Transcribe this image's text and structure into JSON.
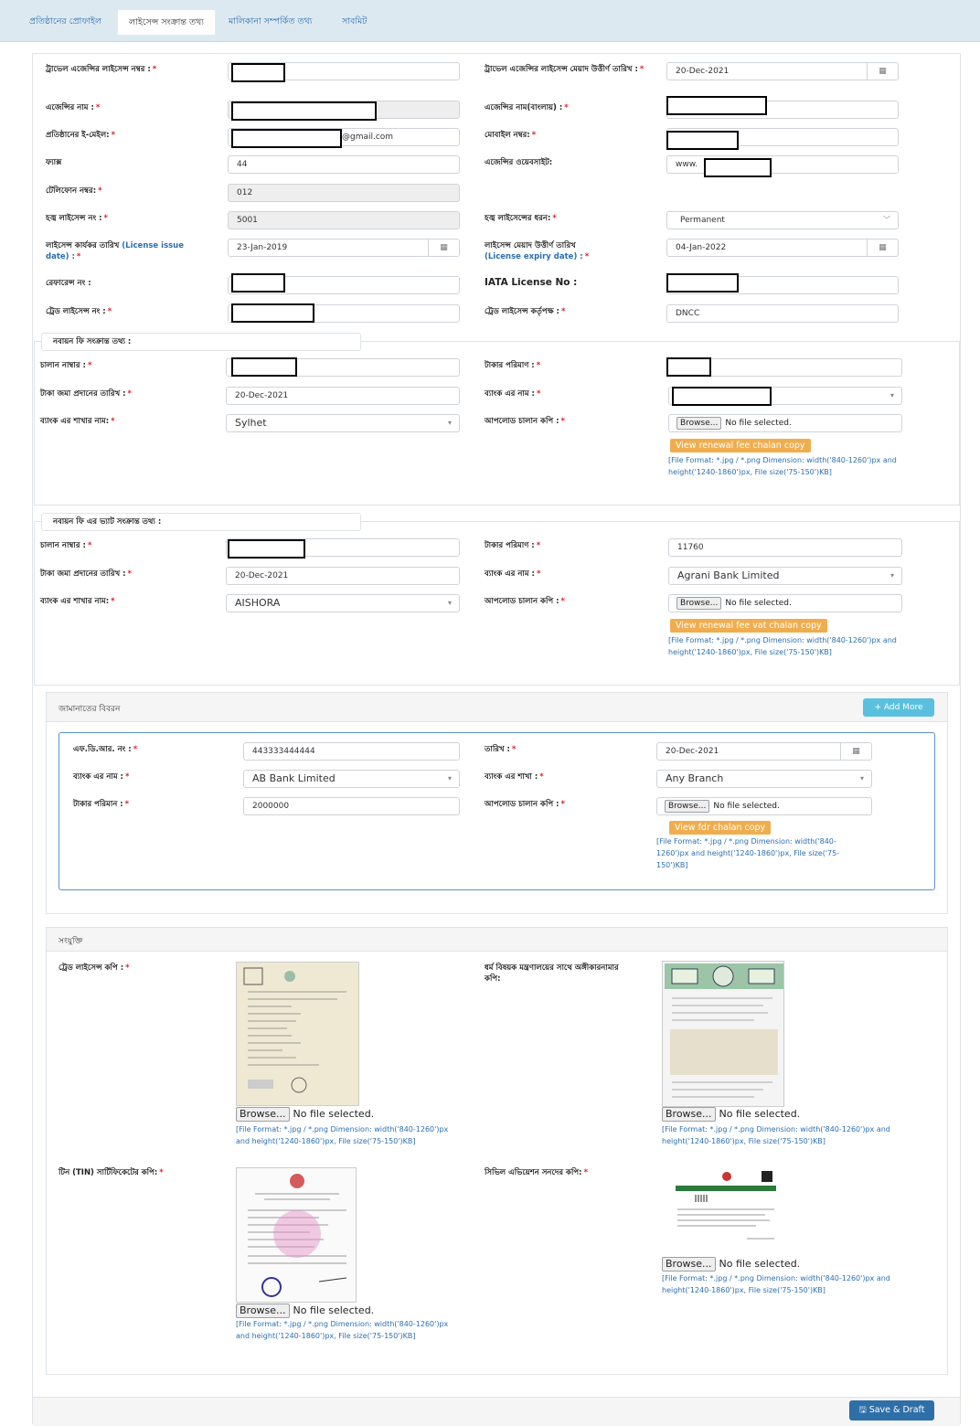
{
  "tabs": [
    {
      "label": "প্রতিষ্ঠানের প্রোফাইল",
      "active": false
    },
    {
      "label": "লাইসেন্স সংক্রান্ত তথ্য",
      "active": true
    },
    {
      "label": "মালিকানা সম্পর্কিত তথ্য",
      "active": false
    },
    {
      "label": "সাবমিট",
      "active": false
    }
  ],
  "license": {
    "travel_license_no_label": "ট্রাভেল এজেন্সির লাইসেন্স নম্বর :",
    "travel_license_expiry_label": "ট্রাভেল এজেন্সির লাইসেন্স মেয়াদ উত্তীর্ণ তারিখ :",
    "travel_license_expiry_value": "20-Dec-2021",
    "agency_name_label": "এজেন্সির নাম :",
    "agency_name_bn_label": "এজেন্সির নাম(বাংলায়) :",
    "email_label": "প্রতিষ্ঠানের ই-মেইল:",
    "email_suffix": "@gmail.com",
    "mobile_label": "মোবাইল নম্বর:",
    "fax_label": "ফ্যাক্স",
    "fax_value": "44",
    "website_label": "এজেন্সির ওয়েবসাইট:",
    "website_prefix": "www.",
    "phone_label": "টেলিফোন নম্বর:",
    "phone_value": "012",
    "hajj_license_label": "হজ্ব লাইসেন্স নং :",
    "hajj_license_value": "5001",
    "hajj_license_type_label": "হজ্ব লাইসেন্সের ধরন:",
    "hajj_license_type_value": "Permanent",
    "issue_date_label_bn": "লাইসেন্স কার্যকর তারিখ",
    "issue_date_label_en": "(License issue date) :",
    "issue_date_value": "23-Jan-2019",
    "expiry_date_label_bn": "লাইসেন্স মেয়াদ উত্তীর্ণ তারিখ",
    "expiry_date_label_en": "(License expiry date) :",
    "expiry_date_value": "04-Jan-2022",
    "reference_label": "রেফারেন্স নং :",
    "iata_label": "IATA License No :",
    "trade_license_label": "ট্রেড লাইসেন্স নং :",
    "trade_authority_label": "ট্রেড লাইসেন্স কর্তৃপক্ষ :",
    "trade_authority_value": "DNCC"
  },
  "renewal_fee": {
    "legend": "নবায়ন ফি সংক্রান্ত তথ্য :",
    "chalan_label": "চালান নাম্বার :",
    "amount_label": "টাকার পরিমাণ :",
    "deposit_date_label": "টাকা জমা প্রদানের তারিখ :",
    "deposit_date_value": "20-Dec-2021",
    "bank_name_label": "ব্যাংক এর নাম :",
    "branch_label": "ব্যাংক এর শাখার নাম:",
    "branch_value": "Sylhet",
    "upload_label": "আপলোড চালান কপি :",
    "browse": "Browse...",
    "no_file": "No file selected.",
    "view_button": "View renewal fee chalan copy",
    "hint": "[File Format: *.jpg / *.png Dimension: width('840-1260')px and height('1240-1860')px, File size('75-150')KB]"
  },
  "renewal_vat": {
    "legend": "নবায়ন ফি এর ভ্যাট সংক্রান্ত তথ্য :",
    "chalan_label": "চালান নাম্বার :",
    "amount_label": "টাকার পরিমাণ :",
    "amount_value": "11760",
    "deposit_date_label": "টাকা জমা প্রদানের তারিখ :",
    "deposit_date_value": "20-Dec-2021",
    "bank_name_label": "ব্যাংক এর নাম :",
    "bank_name_value": "Agrani Bank Limited",
    "branch_label": "ব্যাংক এর শাখার নাম:",
    "branch_value": "AISHORA",
    "upload_label": "আপলোড চালান কপি :",
    "browse": "Browse...",
    "no_file": "No file selected.",
    "view_button": "View renewal fee vat chalan copy",
    "hint": "[File Format: *.jpg / *.png Dimension: width('840-1260')px and height('1240-1860')px, File size('75-150')KB]"
  },
  "guarantee": {
    "heading": "জামানাতের বিবরন",
    "add_more": "+ Add More",
    "fdr_label": "এফ.ডি.আর. নং :",
    "fdr_value": "443333444444",
    "date_label": "তারিখ :",
    "date_value": "20-Dec-2021",
    "bank_label": "ব্যাংক এর নাম :",
    "bank_value": "AB Bank Limited",
    "branch_label": "ব্যাংক এর শাখা :",
    "branch_value": "Any Branch",
    "amount_label": "টাকার পরিমান :",
    "amount_value": "2000000",
    "upload_label": "আপলোড চালান কপি :",
    "browse": "Browse...",
    "no_file": "No file selected.",
    "view_button": "View fdr chalan copy",
    "hint": "[File Format: *.jpg / *.png Dimension: width('840-1260')px and height('1240-1860')px, File size('75-150')KB]"
  },
  "attachments": {
    "heading": "সংযুক্তি",
    "trade_copy_label": "ট্রেড লাইসেন্স কপি :",
    "ministry_copy_label": "ধর্ম বিষয়ক মন্ত্রণালয়ের সাথে অঙ্গীকারনামার কপি:",
    "tin_label": "টিন (TIN) সার্টিফিকেটের কপি:",
    "aviation_label": "সিভিল এভিয়েশন সনদের কপি:",
    "browse": "Browse...",
    "no_file": "No file selected.",
    "hint": "[File Format: *.jpg / *.png Dimension: width('840-1260')px and height('1240-1860')px, File size('75-150')KB]"
  },
  "footer": {
    "save_label": "Save & Draft"
  },
  "colors": {
    "required": "#d9232d",
    "link_blue": "#2a6fb0",
    "orange_button": "#f0ad4e",
    "add_more": "#5bc0de",
    "save_button": "#2f6fa8"
  }
}
